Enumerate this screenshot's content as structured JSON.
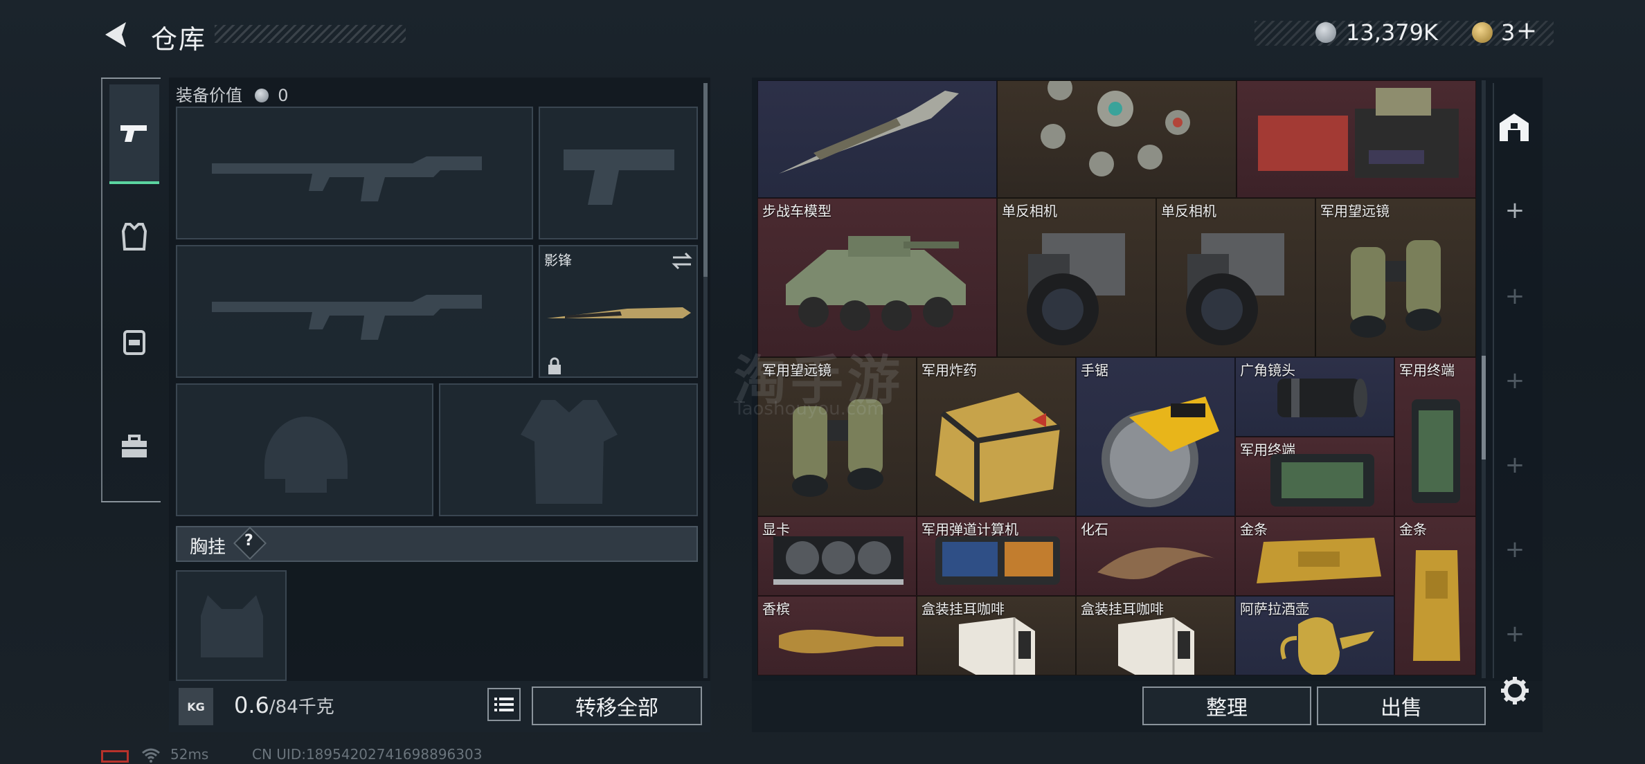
{
  "header": {
    "title": "仓库",
    "silver_amount": "13,379K",
    "gold_amount": "3",
    "gold_plus": "+"
  },
  "equipment": {
    "value_label": "装备价值",
    "value": "0",
    "melee_slot_name": "影锋",
    "chest_rig_label": "胸挂",
    "chest_rig_help": "?"
  },
  "footer": {
    "weight_current": "0.6",
    "weight_max": "/84千克",
    "kg_label": "KG",
    "transfer_all": "转移全部",
    "organize": "整理",
    "sell": "出售"
  },
  "storage_items": [
    {
      "name": "",
      "icon": "combat-knife"
    },
    {
      "name": "",
      "icon": "ornate-necklace"
    },
    {
      "name": "",
      "icon": "ammo-crate"
    },
    {
      "name": "步战车模型",
      "icon": "apc-model"
    },
    {
      "name": "单反相机",
      "icon": "dslr-camera"
    },
    {
      "name": "单反相机",
      "icon": "dslr-camera"
    },
    {
      "name": "军用望远镜",
      "icon": "binoculars"
    },
    {
      "name": "军用望远镜",
      "icon": "binoculars"
    },
    {
      "name": "军用炸药",
      "icon": "explosive-box"
    },
    {
      "name": "手锯",
      "icon": "circular-saw"
    },
    {
      "name": "广角镜头",
      "icon": "camera-lens"
    },
    {
      "name": "军用终端",
      "icon": "rugged-tablet"
    },
    {
      "name": "军用终端",
      "icon": "rugged-tablet"
    },
    {
      "name": "显卡",
      "icon": "graphics-card"
    },
    {
      "name": "军用弹道计算机",
      "icon": "ballistic-computer"
    },
    {
      "name": "化石",
      "icon": "fossil-claw"
    },
    {
      "name": "金条",
      "icon": "gold-bar"
    },
    {
      "name": "金条",
      "icon": "gold-bar"
    },
    {
      "name": "香槟",
      "icon": "champagne-bottle"
    },
    {
      "name": "盒装挂耳咖啡",
      "icon": "coffee-box"
    },
    {
      "name": "盒装挂耳咖啡",
      "icon": "coffee-box"
    },
    {
      "name": "阿萨拉酒壶",
      "icon": "ornate-jug"
    }
  ],
  "status_bar": {
    "ping": "52ms",
    "uid": "CN UID:18954202741698896303"
  },
  "watermark": {
    "main": "淘手游",
    "sub": "Taoshouyou.com"
  },
  "colors": {
    "accent_green": "#5bd4a0",
    "rarity_blue": "#2d3048",
    "rarity_red": "#4a2a30",
    "rarity_brown": "#3c3228"
  }
}
